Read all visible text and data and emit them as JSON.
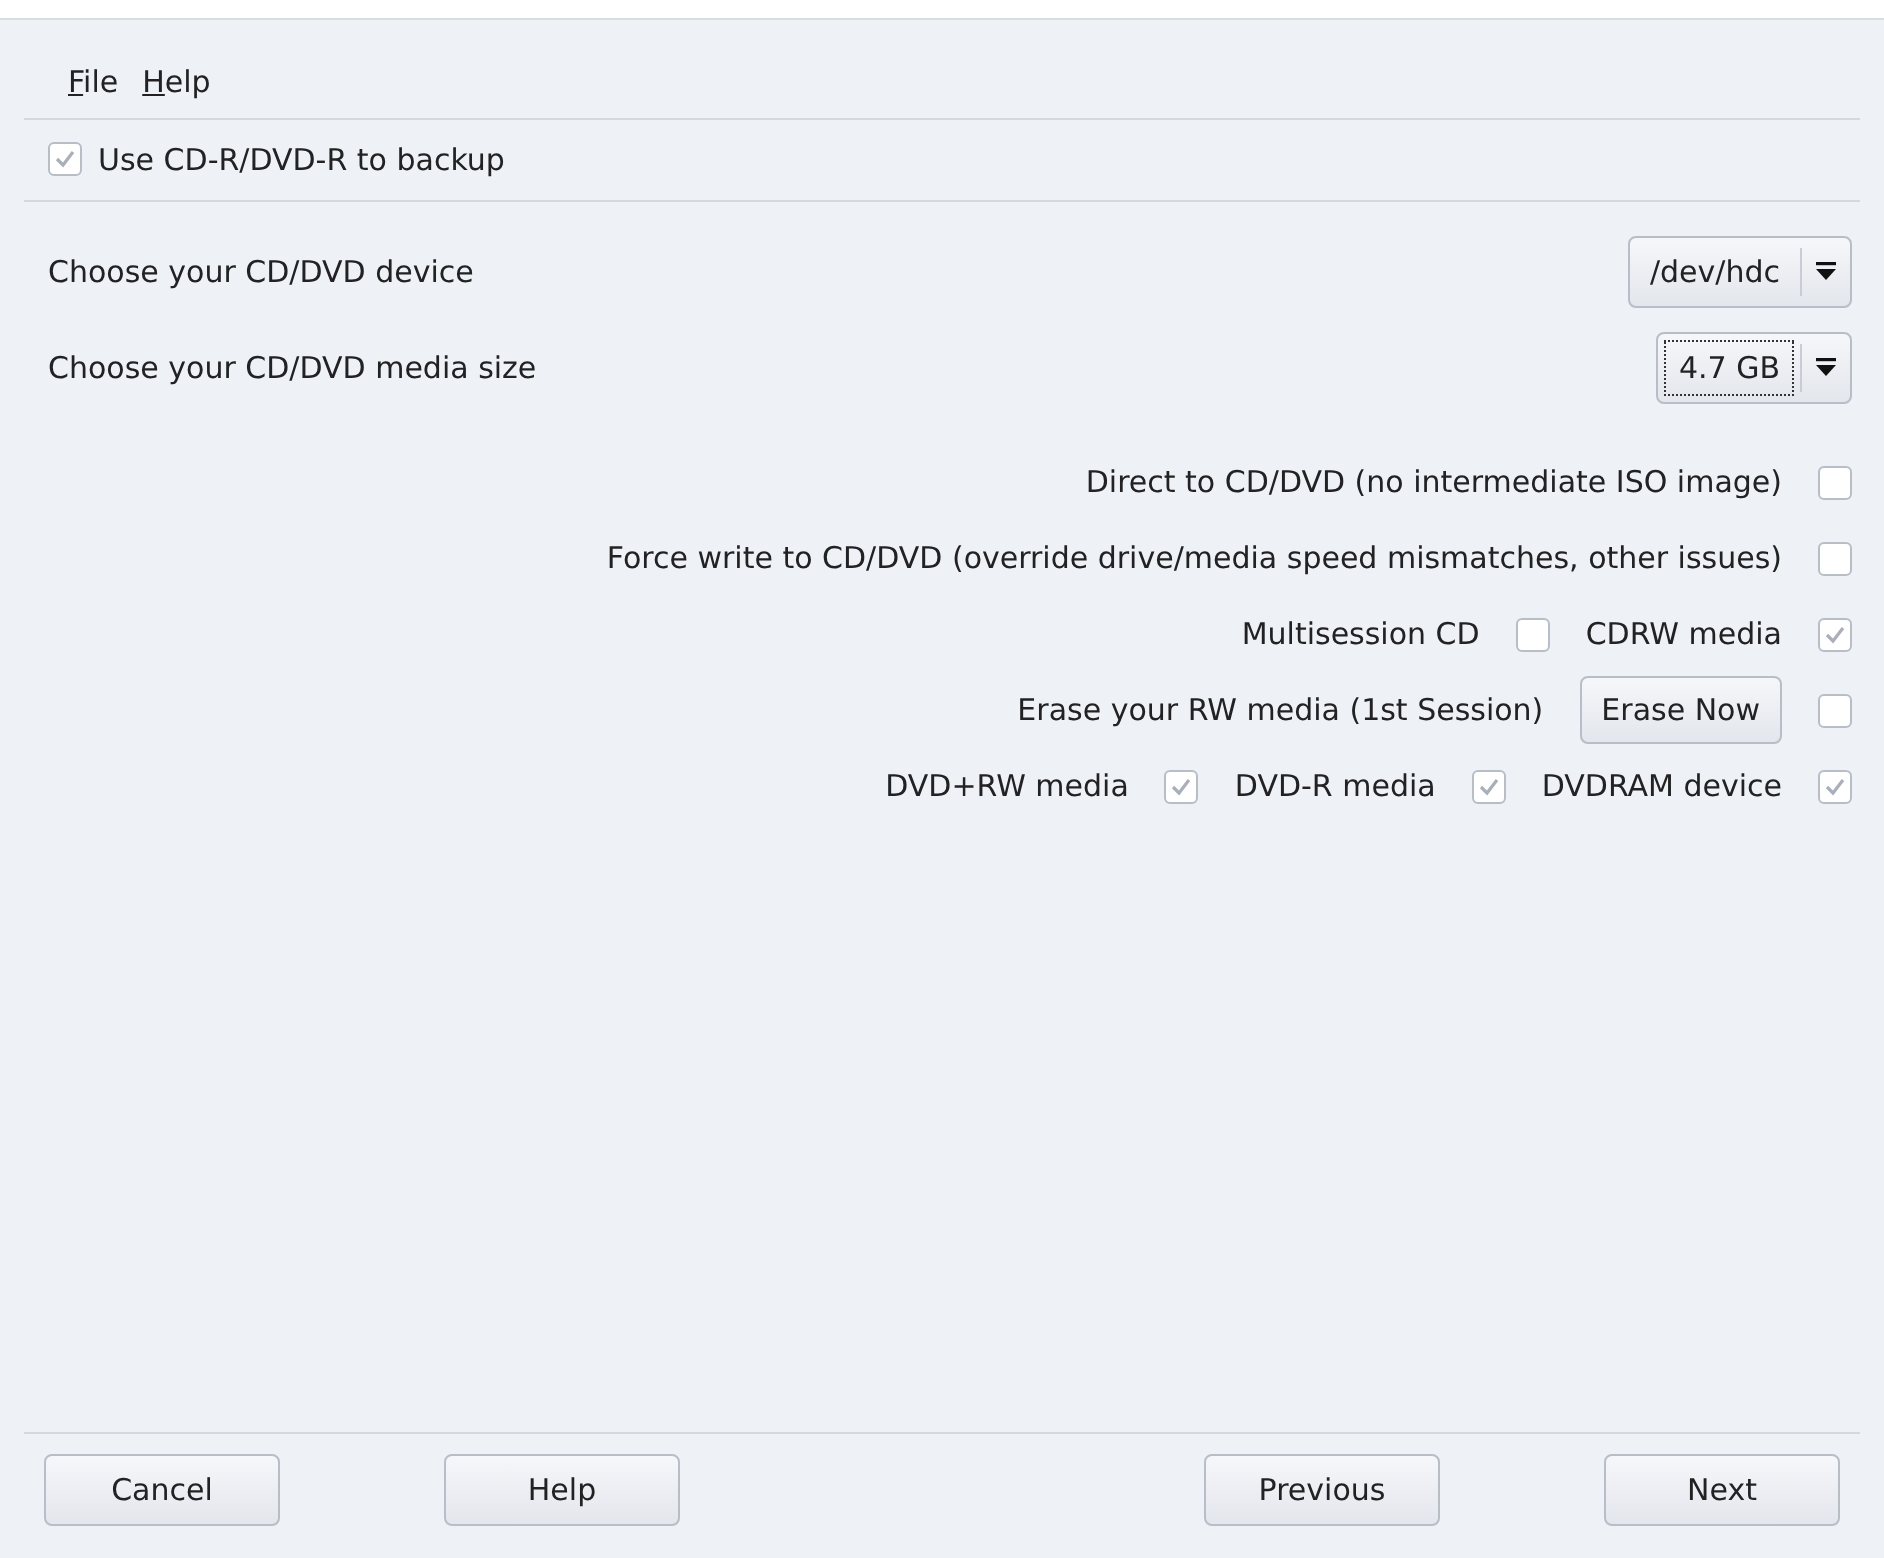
{
  "menu": [
    {
      "mnemonic": "F",
      "rest": "ile"
    },
    {
      "mnemonic": "H",
      "rest": "elp"
    }
  ],
  "use_backup": {
    "label": "Use CD-R/DVD-R to backup",
    "checked": true
  },
  "selects": [
    {
      "label": "Choose your CD/DVD device",
      "value": "/dev/hdc",
      "focused": false
    },
    {
      "label": "Choose your CD/DVD media size",
      "value": "4.7 GB",
      "focused": true
    }
  ],
  "option_rows": [
    {
      "items": [
        {
          "kind": "label",
          "text": "Direct to CD/DVD (no intermediate ISO image)"
        },
        {
          "kind": "checkbox",
          "checked": false
        }
      ]
    },
    {
      "items": [
        {
          "kind": "label",
          "text": "Force write to CD/DVD (override drive/media speed mismatches, other issues)"
        },
        {
          "kind": "checkbox",
          "checked": false
        }
      ]
    },
    {
      "items": [
        {
          "kind": "label",
          "text": "Multisession CD"
        },
        {
          "kind": "checkbox",
          "checked": false
        },
        {
          "kind": "label",
          "text": "CDRW media"
        },
        {
          "kind": "checkbox",
          "checked": true
        }
      ]
    },
    {
      "items": [
        {
          "kind": "label",
          "text": "Erase your RW media (1st Session)"
        },
        {
          "kind": "button",
          "text": "Erase Now"
        },
        {
          "kind": "checkbox",
          "checked": false
        }
      ]
    },
    {
      "items": [
        {
          "kind": "label",
          "text": "DVD+RW media"
        },
        {
          "kind": "checkbox",
          "checked": true
        },
        {
          "kind": "label",
          "text": "DVD-R media"
        },
        {
          "kind": "checkbox",
          "checked": true
        },
        {
          "kind": "label",
          "text": "DVDRAM device"
        },
        {
          "kind": "checkbox",
          "checked": true
        }
      ]
    }
  ],
  "buttons": [
    {
      "label": "Cancel"
    },
    {
      "label": "Help"
    },
    {
      "label": "Previous"
    },
    {
      "label": "Next"
    }
  ]
}
